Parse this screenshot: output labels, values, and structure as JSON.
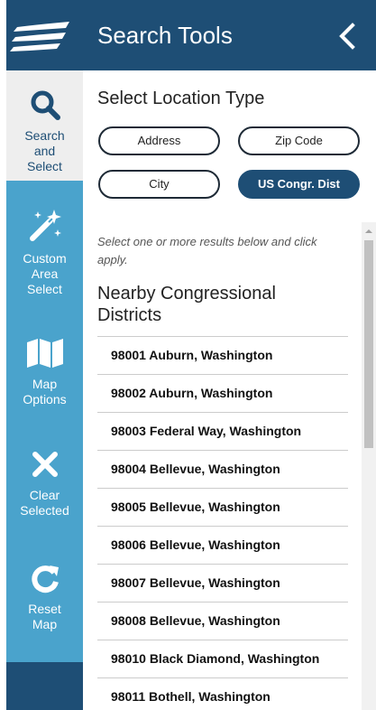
{
  "header": {
    "title": "Search Tools"
  },
  "rail": {
    "search": {
      "line1": "Search",
      "line2": "and",
      "line3": "Select"
    },
    "custom": {
      "line1": "Custom",
      "line2": "Area",
      "line3": "Select"
    },
    "map": {
      "line1": "Map",
      "line2": "Options"
    },
    "clear": {
      "line1": "Clear",
      "line2": "Selected"
    },
    "reset": {
      "line1": "Reset",
      "line2": "Map"
    }
  },
  "panel": {
    "title": "Select Location Type",
    "types": [
      "Address",
      "Zip Code",
      "City",
      "US Congr. Dist"
    ],
    "selected_type": "US Congr. Dist",
    "hint": "Select one or more results below and click apply.",
    "results_heading": "Nearby Congressional Districts",
    "results": [
      "98001 Auburn, Washington",
      "98002 Auburn, Washington",
      "98003 Federal Way, Washington",
      "98004 Bellevue, Washington",
      "98005 Bellevue, Washington",
      "98006 Bellevue, Washington",
      "98007 Bellevue, Washington",
      "98008 Bellevue, Washington",
      "98010 Black Diamond, Washington",
      "98011 Bothell, Washington"
    ]
  },
  "colors": {
    "navy": "#1e4e75",
    "rail": "#4aa3cc",
    "active_rail": "#eeeeee"
  }
}
